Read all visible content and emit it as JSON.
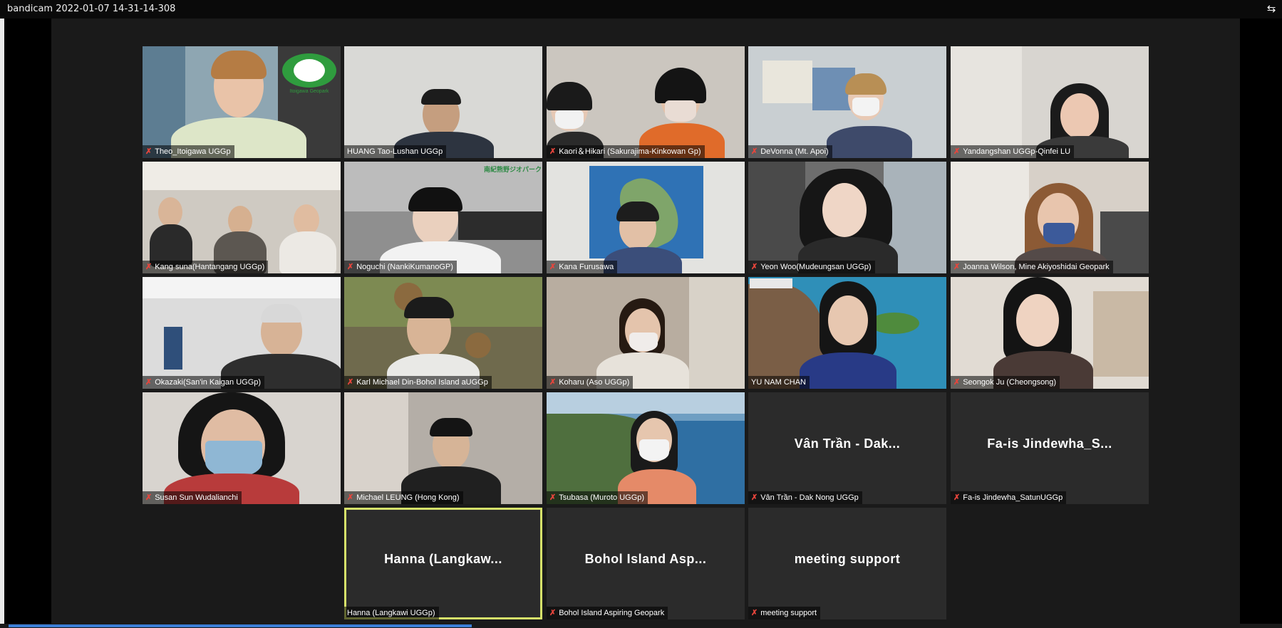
{
  "window": {
    "title": "bandicam 2022-01-07 14-31-14-308",
    "control_icon": "gallery-layout-icon"
  },
  "participants": [
    {
      "name": "Theo_Itoigawa UGGp",
      "overlay": "Itoigawa Geopark",
      "muted": true
    },
    {
      "name": "HUANG Tao-Lushan UGGp",
      "muted": true
    },
    {
      "name": "Kaori＆Hikari (Sakurajima-Kinkowan Gp)",
      "muted": true
    },
    {
      "name": "DeVonna (Mt. Apoi)",
      "muted": true
    },
    {
      "name": "Yandangshan UGGp-Qinfei LU",
      "muted": true
    },
    {
      "name": "Kang suna(Hantangang UGGp)",
      "muted": true
    },
    {
      "name": "Noguchi (NankiKumanoGP)",
      "overlay": "南紀熊野ジオパーク",
      "muted": true
    },
    {
      "name": "Kana Furusawa",
      "muted": true
    },
    {
      "name": "Yeon Woo(Mudeungsan UGGp)",
      "muted": true
    },
    {
      "name": "Joanna Wilson, Mine Akiyoshidai Geopark",
      "muted": true
    },
    {
      "name": "Okazaki(San'in Kaigan UGGp)",
      "muted": true
    },
    {
      "name": "Karl Michael Din-Bohol Island aUGGp",
      "muted": true
    },
    {
      "name": "Koharu (Aso UGGp)",
      "muted": true
    },
    {
      "name": "YU NAM CHAN",
      "muted": false
    },
    {
      "name": "Seongok Ju (Cheongsong)",
      "muted": true
    },
    {
      "name": "Susan Sun Wudalianchi",
      "muted": true
    },
    {
      "name": "Michael LEUNG (Hong Kong)",
      "muted": true
    },
    {
      "name": "Tsubasa (Muroto UGGp)",
      "muted": true
    },
    {
      "name": "Vân Trần - Dak Nong UGGp",
      "display": "Vân Trần - Dak...",
      "muted": true
    },
    {
      "name": "Fa-is Jindewha_SatunUGGp",
      "display": "Fa-is Jindewha_S...",
      "muted": true
    },
    {
      "name": "Hanna (Langkawi UGGp)",
      "display": "Hanna (Langkaw...",
      "muted": false,
      "active_speaker": true
    },
    {
      "name": "Bohol Island Aspiring Geopark",
      "display": "Bohol Island Asp...",
      "muted": true
    },
    {
      "name": "meeting support",
      "display": "meeting support",
      "muted": true
    }
  ],
  "colors": {
    "active_border": "#d6e16a",
    "mute_icon": "#e8453c",
    "progress": "#3c7fd8"
  },
  "mute_icon_glyph": "✗"
}
